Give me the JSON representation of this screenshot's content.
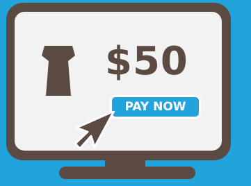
{
  "price": {
    "amount": "$50"
  },
  "button": {
    "label": "PAY NOW"
  },
  "colors": {
    "background": "#22a3dc",
    "monitor": "#5b4a42",
    "screen": "#f2f2f2",
    "button": "#22a3dc",
    "button_text": "#ffffff"
  },
  "icons": {
    "keystone": "keystone-icon",
    "cursor": "mouse-pointer-icon"
  }
}
